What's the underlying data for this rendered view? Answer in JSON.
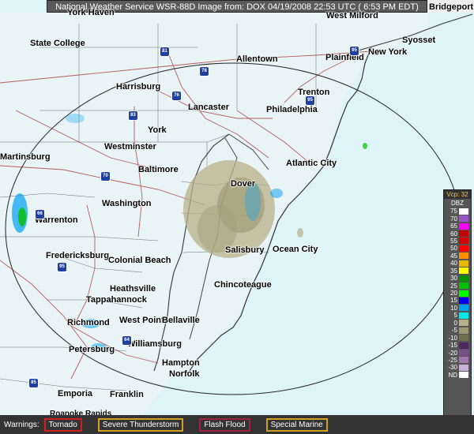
{
  "header": {
    "text": "National Weather Service WSR-88D Image from: DOX 04/19/2008 22:53 UTC ( 6:53 PM EDT)"
  },
  "cities": [
    {
      "id": "york-haven",
      "label": "York Haven"
    },
    {
      "id": "westmilford",
      "label": "West Milford"
    },
    {
      "id": "bridgeport",
      "label": "Bridgeport"
    },
    {
      "id": "state-college",
      "label": "State College"
    },
    {
      "id": "syosset",
      "label": "Syosset"
    },
    {
      "id": "allentown",
      "label": "Allentown"
    },
    {
      "id": "plainfield",
      "label": "Plainfield"
    },
    {
      "id": "new-york",
      "label": "New York"
    },
    {
      "id": "harrisburg",
      "label": "Harrisburg"
    },
    {
      "id": "trenton",
      "label": "Trenton"
    },
    {
      "id": "lancaster",
      "label": "Lancaster"
    },
    {
      "id": "philadelphia",
      "label": "Philadelphia"
    },
    {
      "id": "york",
      "label": "York"
    },
    {
      "id": "westminster",
      "label": "Westminster"
    },
    {
      "id": "martinsburg",
      "label": "Martinsburg"
    },
    {
      "id": "atlantic-city",
      "label": "Atlantic City"
    },
    {
      "id": "baltimore",
      "label": "Baltimore"
    },
    {
      "id": "dover",
      "label": "Dover"
    },
    {
      "id": "washington",
      "label": "Washington"
    },
    {
      "id": "warrenton",
      "label": "Warrenton"
    },
    {
      "id": "salisbury",
      "label": "Salisbury"
    },
    {
      "id": "ocean-city",
      "label": "Ocean City"
    },
    {
      "id": "fredericksburg",
      "label": "Fredericksburg"
    },
    {
      "id": "colonial-beach",
      "label": "Colonial Beach"
    },
    {
      "id": "chincoteague",
      "label": "Chincoteague"
    },
    {
      "id": "heathsville",
      "label": "Heathsville"
    },
    {
      "id": "tappahannock",
      "label": "Tappahannock"
    },
    {
      "id": "richmond",
      "label": "Richmond"
    },
    {
      "id": "west-point",
      "label": "West Point"
    },
    {
      "id": "bellaville",
      "label": "Bellaville"
    },
    {
      "id": "williamsburg",
      "label": "Williamsburg"
    },
    {
      "id": "petersburg",
      "label": "Petersburg"
    },
    {
      "id": "hampton",
      "label": "Hampton"
    },
    {
      "id": "norfolk",
      "label": "Norfolk"
    },
    {
      "id": "emporia",
      "label": "Emporia"
    },
    {
      "id": "franklin",
      "label": "Franklin"
    },
    {
      "id": "roanoke-rapids",
      "label": "Roanoke Rapids"
    }
  ],
  "shields": [
    "81",
    "78",
    "76",
    "95",
    "83",
    "70",
    "66",
    "95",
    "64",
    "85",
    "95"
  ],
  "legend": {
    "top": "Vcp: 32",
    "unit": "DBZ",
    "rows": [
      {
        "v": "75",
        "c": "#ffffff"
      },
      {
        "v": "70",
        "c": "#9955c9"
      },
      {
        "v": "65",
        "c": "#ff00ff"
      },
      {
        "v": "60",
        "c": "#c00000"
      },
      {
        "v": "55",
        "c": "#d40000"
      },
      {
        "v": "50",
        "c": "#ff0000"
      },
      {
        "v": "45",
        "c": "#ff9000"
      },
      {
        "v": "40",
        "c": "#e8b800"
      },
      {
        "v": "35",
        "c": "#ffff00"
      },
      {
        "v": "30",
        "c": "#008f00"
      },
      {
        "v": "25",
        "c": "#00c000"
      },
      {
        "v": "20",
        "c": "#00ff00"
      },
      {
        "v": "15",
        "c": "#0000f0"
      },
      {
        "v": "10",
        "c": "#00a0f0"
      },
      {
        "v": "5",
        "c": "#00e8e8"
      },
      {
        "v": "0",
        "c": "#b8b088"
      },
      {
        "v": "-5",
        "c": "#9c9870"
      },
      {
        "v": "-10",
        "c": "#707050"
      },
      {
        "v": "-15",
        "c": "#502860"
      },
      {
        "v": "-20",
        "c": "#785088"
      },
      {
        "v": "-25",
        "c": "#a078b0"
      },
      {
        "v": "-30",
        "c": "#c8b0d8"
      },
      {
        "v": "ND",
        "c": "#ffffff"
      }
    ]
  },
  "warnings": {
    "label": "Warnings:",
    "items": [
      "Tornado",
      "Severe Thunderstorm",
      "Flash Flood",
      "Special Marine"
    ]
  }
}
